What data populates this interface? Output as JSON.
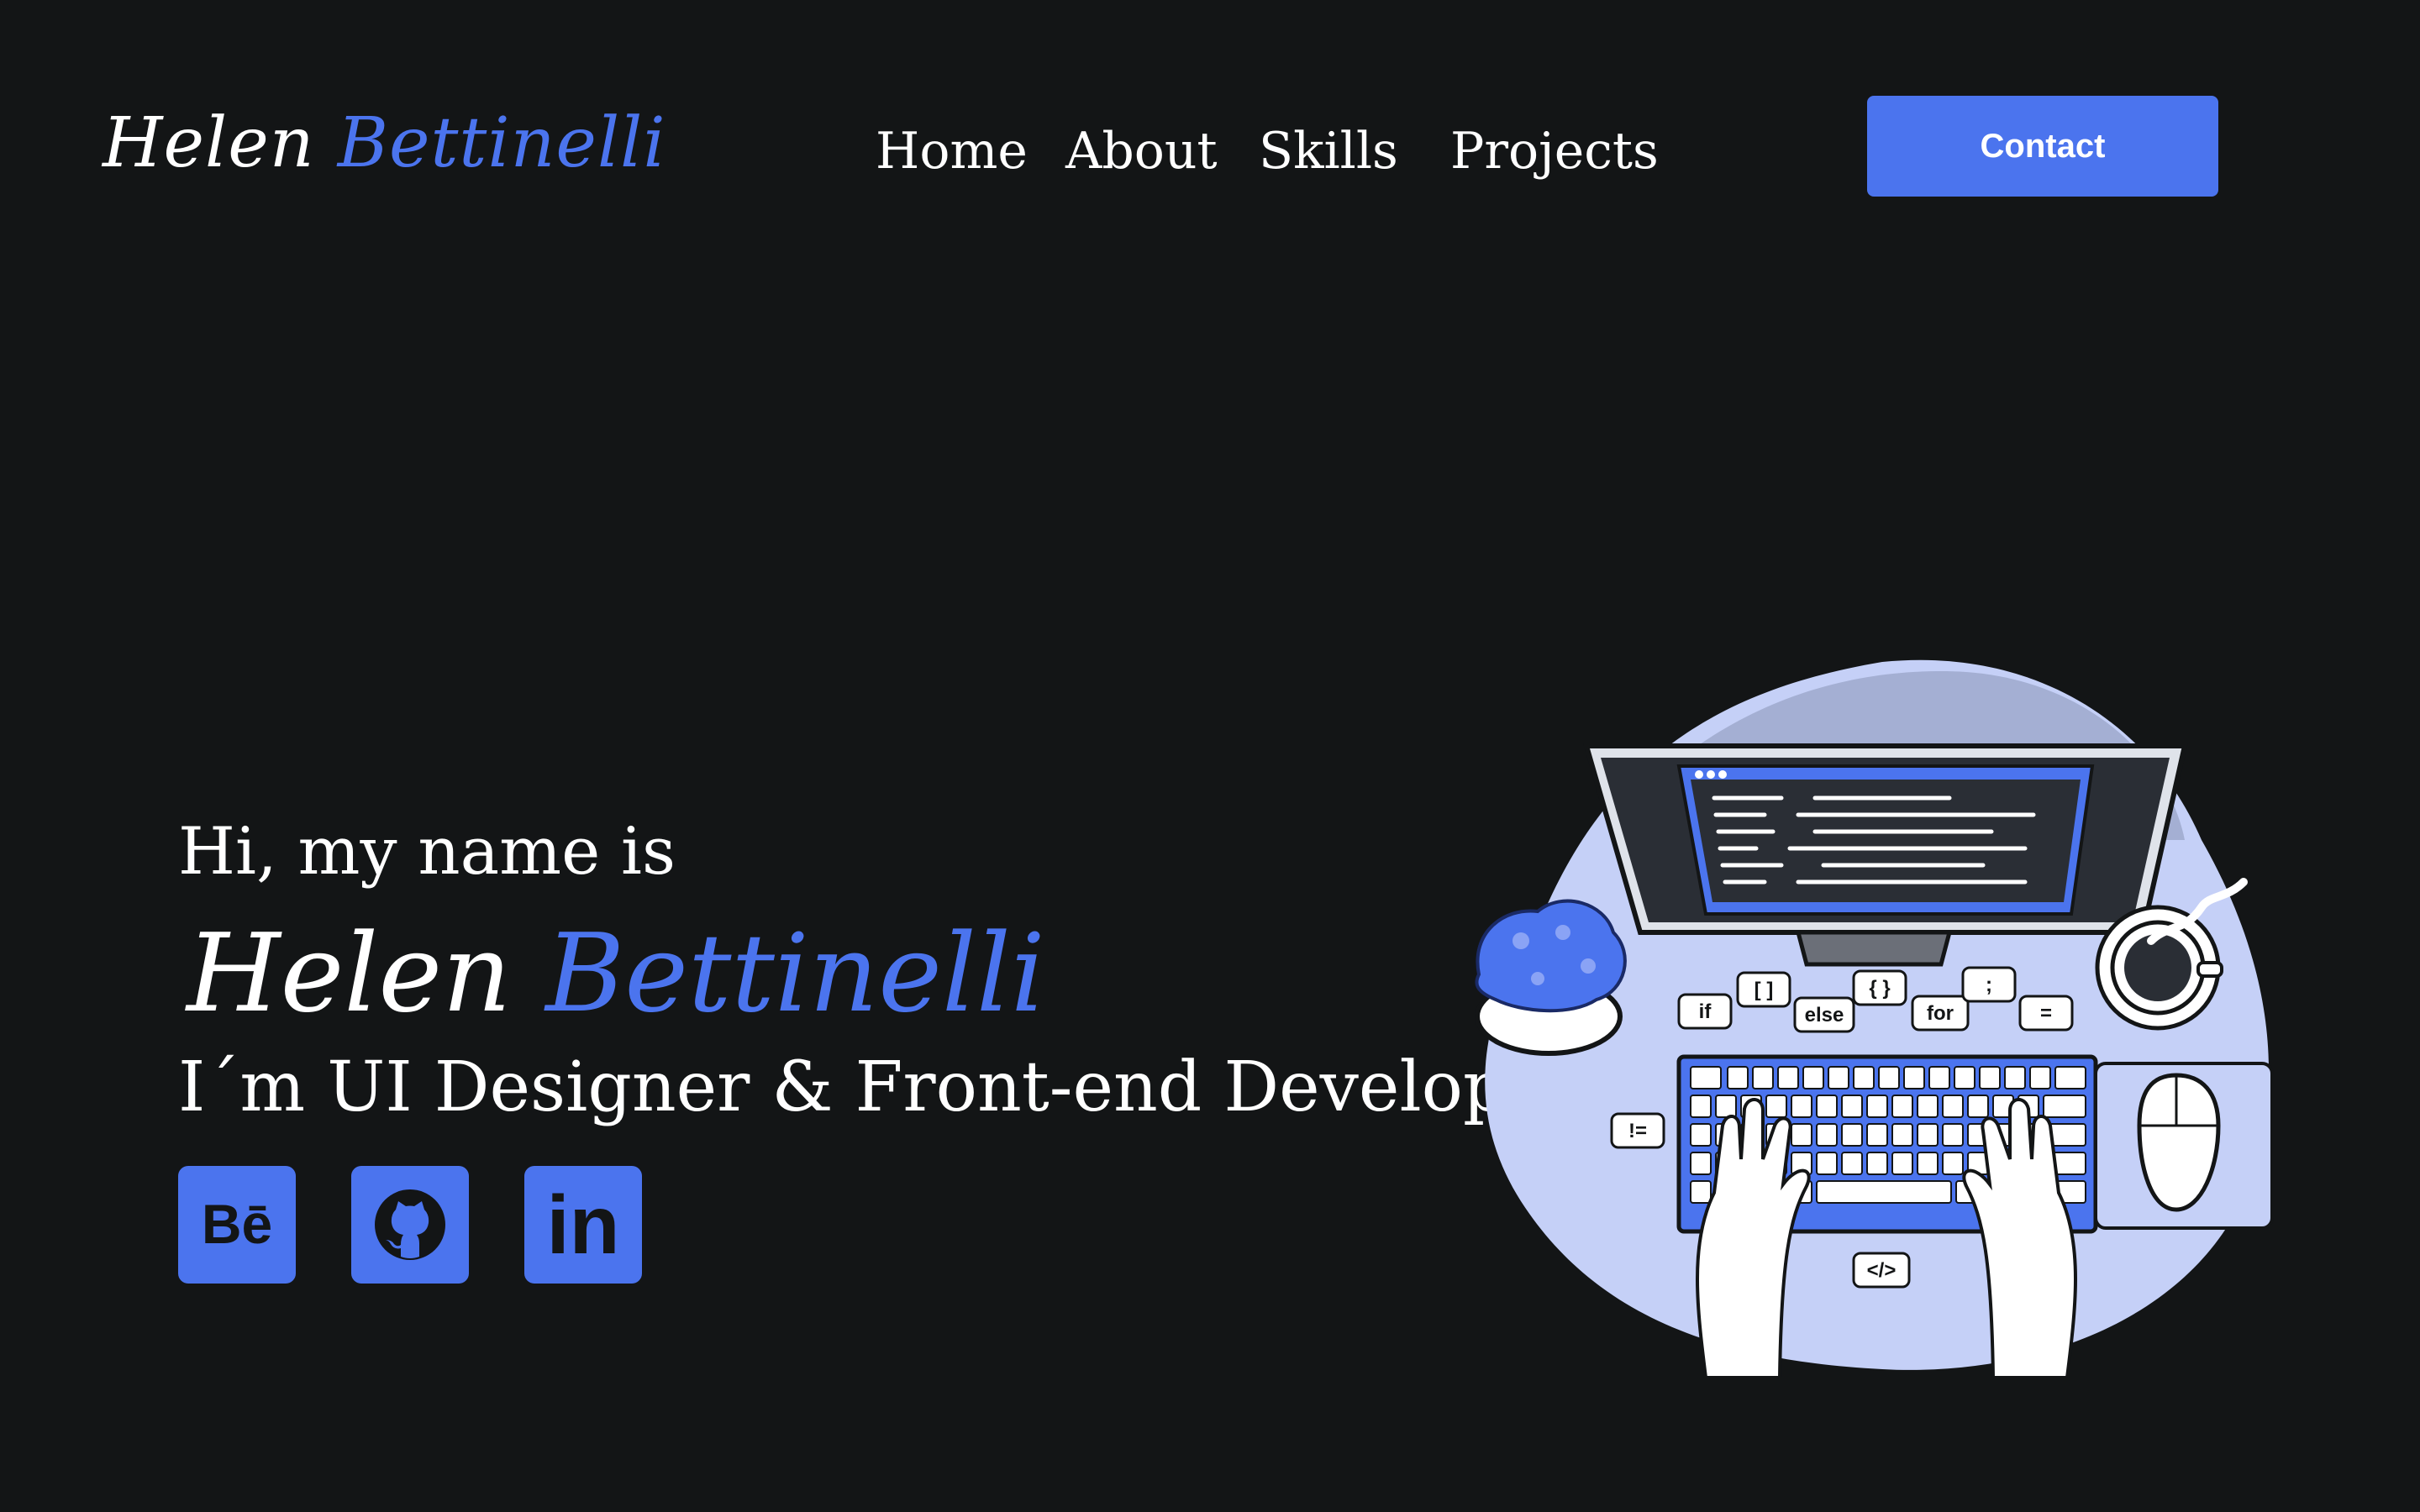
{
  "brand": {
    "first": "Helen",
    "last": "Bettinelli"
  },
  "nav": {
    "home": "Home",
    "about": "About",
    "skills": "Skills",
    "projects": "Projects"
  },
  "contact_button": "Contact",
  "hero": {
    "greeting": "Hi, my name is",
    "first_name": "Helen",
    "last_name": "Bettinelli",
    "role": "I´m UI Designer & Front-end Developer"
  },
  "social": {
    "behance_glyph": "Bē",
    "github_icon": "github-icon",
    "linkedin_glyph": "in"
  },
  "illustration": {
    "bubbles": [
      "if",
      "[ ]",
      "else",
      "{ }",
      "for",
      ";",
      "=",
      "!=",
      "</>"
    ]
  },
  "colors": {
    "background": "#131516",
    "accent": "#4b74ee",
    "text": "#ffffff",
    "blob": "#c5d0f7"
  }
}
